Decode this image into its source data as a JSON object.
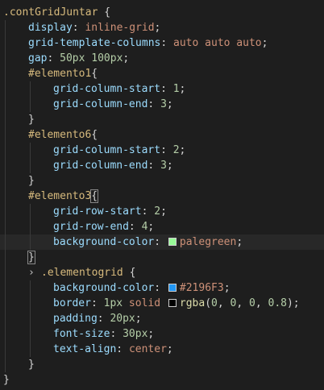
{
  "editor": {
    "lines": [
      {
        "indent": 0,
        "tokens": [
          {
            "t": ".contGridJuntar",
            "c": "c-sel"
          },
          {
            "t": " {",
            "c": "c-brace"
          }
        ]
      },
      {
        "indent": 1,
        "tokens": [
          {
            "t": "display",
            "c": "c-prop"
          },
          {
            "t": ": ",
            "c": "c-punct"
          },
          {
            "t": "inline-grid",
            "c": "c-val"
          },
          {
            "t": ";",
            "c": "c-punct"
          }
        ]
      },
      {
        "indent": 1,
        "tokens": [
          {
            "t": "grid-template-columns",
            "c": "c-prop"
          },
          {
            "t": ": ",
            "c": "c-punct"
          },
          {
            "t": "auto auto auto",
            "c": "c-val"
          },
          {
            "t": ";",
            "c": "c-punct"
          }
        ]
      },
      {
        "indent": 1,
        "tokens": [
          {
            "t": "gap",
            "c": "c-prop"
          },
          {
            "t": ": ",
            "c": "c-punct"
          },
          {
            "t": "50px 100px",
            "c": "c-num"
          },
          {
            "t": ";",
            "c": "c-punct"
          }
        ]
      },
      {
        "indent": 1,
        "tokens": [
          {
            "t": "#elemento1",
            "c": "c-sel"
          },
          {
            "t": "{",
            "c": "c-brace"
          }
        ]
      },
      {
        "indent": 2,
        "tokens": [
          {
            "t": "grid-column-start",
            "c": "c-prop"
          },
          {
            "t": ": ",
            "c": "c-punct"
          },
          {
            "t": "1",
            "c": "c-num"
          },
          {
            "t": ";",
            "c": "c-punct"
          }
        ]
      },
      {
        "indent": 2,
        "tokens": [
          {
            "t": "grid-column-end",
            "c": "c-prop"
          },
          {
            "t": ": ",
            "c": "c-punct"
          },
          {
            "t": "3",
            "c": "c-num"
          },
          {
            "t": ";",
            "c": "c-punct"
          }
        ]
      },
      {
        "indent": 1,
        "tokens": [
          {
            "t": "}",
            "c": "c-brace"
          }
        ]
      },
      {
        "indent": 1,
        "tokens": [
          {
            "t": "#elemento6",
            "c": "c-sel"
          },
          {
            "t": "{",
            "c": "c-brace"
          }
        ]
      },
      {
        "indent": 2,
        "tokens": [
          {
            "t": "grid-column-start",
            "c": "c-prop"
          },
          {
            "t": ": ",
            "c": "c-punct"
          },
          {
            "t": "2",
            "c": "c-num"
          },
          {
            "t": ";",
            "c": "c-punct"
          }
        ]
      },
      {
        "indent": 2,
        "tokens": [
          {
            "t": "grid-column-end",
            "c": "c-prop"
          },
          {
            "t": ": ",
            "c": "c-punct"
          },
          {
            "t": "3",
            "c": "c-num"
          },
          {
            "t": ";",
            "c": "c-punct"
          }
        ]
      },
      {
        "indent": 1,
        "tokens": [
          {
            "t": "}",
            "c": "c-brace"
          }
        ]
      },
      {
        "indent": 1,
        "tokens": [
          {
            "t": "#elemento3",
            "c": "c-sel"
          },
          {
            "t": "{",
            "c": "c-brace c-bracket-match"
          }
        ]
      },
      {
        "indent": 2,
        "tokens": [
          {
            "t": "grid-row-start",
            "c": "c-prop"
          },
          {
            "t": ": ",
            "c": "c-punct"
          },
          {
            "t": "2",
            "c": "c-num"
          },
          {
            "t": ";",
            "c": "c-punct"
          }
        ]
      },
      {
        "indent": 2,
        "tokens": [
          {
            "t": "grid-row-end",
            "c": "c-prop"
          },
          {
            "t": ": ",
            "c": "c-punct"
          },
          {
            "t": "4",
            "c": "c-num"
          },
          {
            "t": ";",
            "c": "c-punct"
          }
        ]
      },
      {
        "indent": 2,
        "current": true,
        "tokens": [
          {
            "t": "background-color",
            "c": "c-prop"
          },
          {
            "t": ": ",
            "c": "c-punct"
          },
          {
            "swatch": "#98fb98"
          },
          {
            "t": "palegreen",
            "c": "c-val"
          },
          {
            "t": ";",
            "c": "c-punct"
          }
        ]
      },
      {
        "indent": 1,
        "tokens": [
          {
            "t": "}",
            "c": "c-brace c-bracket-match"
          }
        ]
      },
      {
        "indent": 1,
        "fold": true,
        "tokens": [
          {
            "t": ".elementogrid",
            "c": "c-sel"
          },
          {
            "t": " {",
            "c": "c-brace"
          }
        ]
      },
      {
        "indent": 2,
        "tokens": [
          {
            "t": "background-color",
            "c": "c-prop"
          },
          {
            "t": ": ",
            "c": "c-punct"
          },
          {
            "swatch": "#2196f3"
          },
          {
            "t": "#2196F3",
            "c": "c-val"
          },
          {
            "t": ";",
            "c": "c-punct"
          }
        ]
      },
      {
        "indent": 2,
        "tokens": [
          {
            "t": "border",
            "c": "c-prop"
          },
          {
            "t": ": ",
            "c": "c-punct"
          },
          {
            "t": "1px",
            "c": "c-num"
          },
          {
            "t": " solid ",
            "c": "c-val"
          },
          {
            "swatch": "#000000"
          },
          {
            "t": "rgba",
            "c": "c-fn"
          },
          {
            "t": "(",
            "c": "c-punct"
          },
          {
            "t": "0",
            "c": "c-num"
          },
          {
            "t": ", ",
            "c": "c-punct"
          },
          {
            "t": "0",
            "c": "c-num"
          },
          {
            "t": ", ",
            "c": "c-punct"
          },
          {
            "t": "0",
            "c": "c-num"
          },
          {
            "t": ", ",
            "c": "c-punct"
          },
          {
            "t": "0.8",
            "c": "c-num"
          },
          {
            "t": ");",
            "c": "c-punct"
          }
        ]
      },
      {
        "indent": 2,
        "tokens": [
          {
            "t": "padding",
            "c": "c-prop"
          },
          {
            "t": ": ",
            "c": "c-punct"
          },
          {
            "t": "20px",
            "c": "c-num"
          },
          {
            "t": ";",
            "c": "c-punct"
          }
        ]
      },
      {
        "indent": 2,
        "tokens": [
          {
            "t": "font-size",
            "c": "c-prop"
          },
          {
            "t": ": ",
            "c": "c-punct"
          },
          {
            "t": "30px",
            "c": "c-num"
          },
          {
            "t": ";",
            "c": "c-punct"
          }
        ]
      },
      {
        "indent": 2,
        "tokens": [
          {
            "t": "text-align",
            "c": "c-prop"
          },
          {
            "t": ": ",
            "c": "c-punct"
          },
          {
            "t": "center",
            "c": "c-val"
          },
          {
            "t": ";",
            "c": "c-punct"
          }
        ]
      },
      {
        "indent": 1,
        "tokens": [
          {
            "t": "}",
            "c": "c-brace"
          }
        ]
      },
      {
        "indent": 0,
        "tokens": [
          {
            "t": "}",
            "c": "c-brace"
          }
        ]
      }
    ],
    "fold_icon": "chevron-right-icon",
    "fold_glyph": "›",
    "colors": {
      "background": "#1e1e1e",
      "selector": "#d7ba7d",
      "property": "#9cdcfe",
      "value": "#ce9178",
      "number": "#b5cea8",
      "function": "#dcdcaa"
    }
  }
}
